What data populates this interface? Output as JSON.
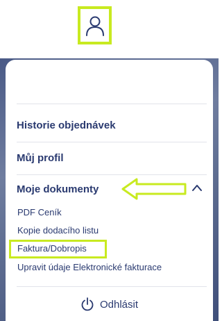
{
  "header": {
    "user_icon": "user-icon",
    "highlight_color": "#c8ea20"
  },
  "menu": {
    "items": [
      {
        "label": "Historie objednávek"
      },
      {
        "label": "Můj profil"
      },
      {
        "label": "Moje dokumenty",
        "expanded": true
      }
    ],
    "documents": [
      {
        "label": "PDF Ceník"
      },
      {
        "label": "Kopie dodacího listu"
      },
      {
        "label": "Faktura/Dobropis",
        "highlighted": true
      },
      {
        "label": "Upravit údaje Elektronické fakturace"
      }
    ],
    "logout": {
      "label": "Odhlásit",
      "icon": "power-icon"
    }
  },
  "colors": {
    "text": "#2a3a70",
    "accent": "#c8ea20",
    "divider": "#e1e3ea"
  }
}
